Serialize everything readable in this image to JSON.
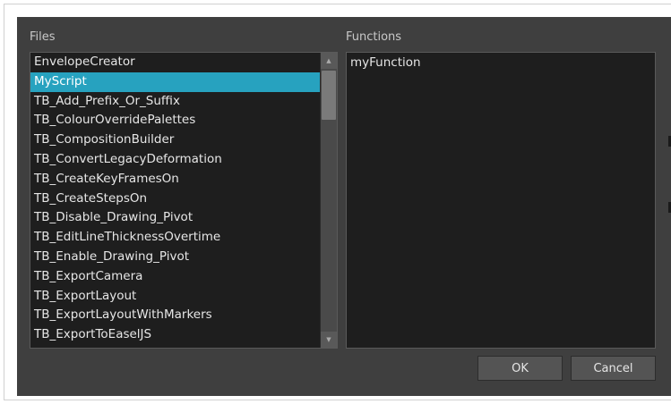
{
  "files": {
    "label": "Files",
    "selected_index": 1,
    "items": [
      "EnvelopeCreator",
      "MyScript",
      "TB_Add_Prefix_Or_Suffix",
      "TB_ColourOverridePalettes",
      "TB_CompositionBuilder",
      "TB_ConvertLegacyDeformation",
      "TB_CreateKeyFramesOn",
      "TB_CreateStepsOn",
      "TB_Disable_Drawing_Pivot",
      "TB_EditLineThicknessOvertime",
      "TB_Enable_Drawing_Pivot",
      "TB_ExportCamera",
      "TB_ExportLayout",
      "TB_ExportLayoutWithMarkers",
      "TB_ExportToEaselJS"
    ]
  },
  "functions": {
    "label": "Functions",
    "items": [
      "myFunction"
    ]
  },
  "buttons": {
    "ok": "OK",
    "cancel": "Cancel"
  },
  "colors": {
    "dialog_bg": "#3f3f3f",
    "list_bg": "#1e1e1e",
    "selection": "#27a2bf",
    "text": "#e6e6e6"
  }
}
